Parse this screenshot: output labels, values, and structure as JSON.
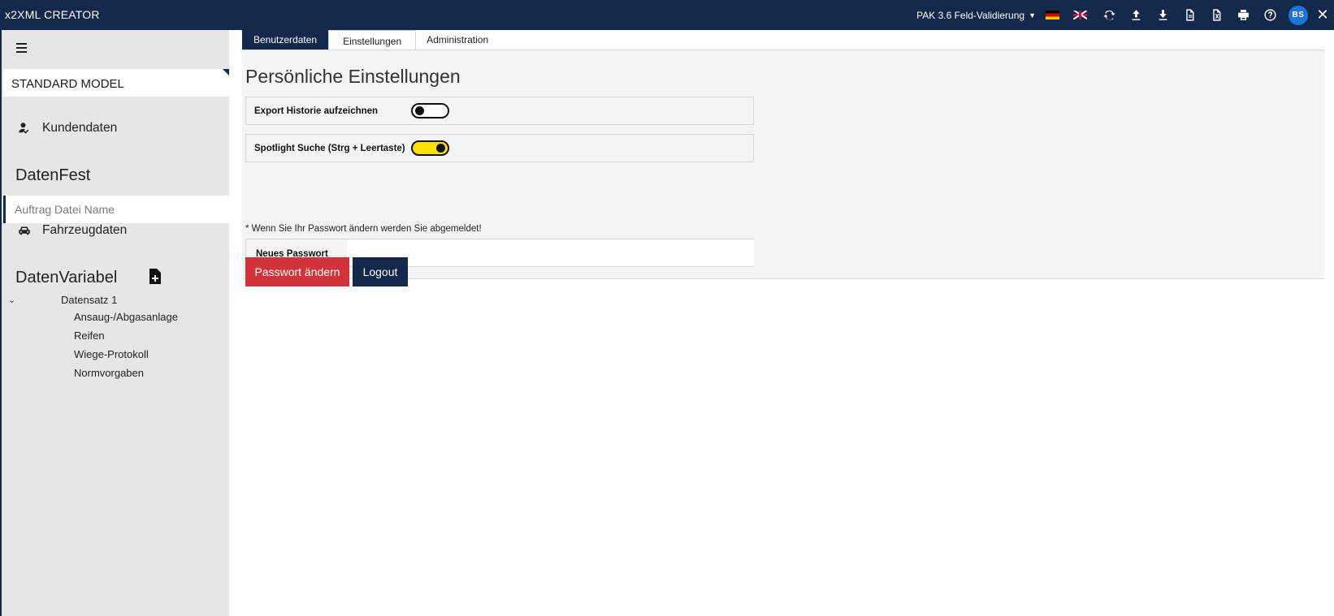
{
  "app": {
    "title": "x2XML CREATOR"
  },
  "topbar": {
    "model_selector": "PAK 3.6 Feld-Validierung",
    "avatar_initials": "BS",
    "icons": [
      "flag-de-icon",
      "flag-uk-icon",
      "refresh-icon",
      "upload-icon",
      "download-icon",
      "document-icon",
      "excel-icon",
      "print-icon",
      "help-icon",
      "close-icon"
    ]
  },
  "sidebar": {
    "model_name": "STANDARD MODEL",
    "kundendaten_label": "Kundendaten",
    "datenfest_title": "DatenFest",
    "auftrag_placeholder": "Auftrag Datei Name",
    "fahrzeugdaten_label": "Fahrzeugdaten",
    "datenvariabel_title": "DatenVariabel",
    "tree": {
      "root": "Datensatz 1",
      "children": [
        "Ansaug-/Abgasanlage",
        "Reifen",
        "Wiege-Protokoll",
        "Normvorgaben"
      ]
    }
  },
  "main": {
    "tabs": [
      "Benutzerdaten",
      "Einstellungen",
      "Administration"
    ],
    "panel_title": "Persönliche Einstellungen",
    "settings": [
      {
        "label": "Export Historie aufzeichnen",
        "enabled": false
      },
      {
        "label": "Spotlight Suche (Strg + Leertaste)",
        "enabled": true
      }
    ],
    "password_note": "* Wenn Sie Ihr Passwort ändern werden Sie abgemeldet!",
    "new_password_label": "Neues Passwort",
    "change_password_button": "Passwort ändern",
    "logout_button": "Logout"
  },
  "colors": {
    "primary": "#13294b",
    "danger": "#d13438",
    "toggle_on": "#ffe000",
    "avatar": "#1e73d8"
  }
}
